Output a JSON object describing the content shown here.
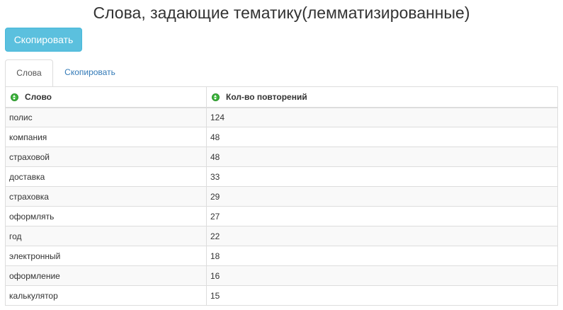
{
  "page": {
    "title": "Слова, задающие тематику(лемматизированные)"
  },
  "toolbar": {
    "copy_label": "Скопировать"
  },
  "tabs": [
    {
      "label": "Слова",
      "active": true
    },
    {
      "label": "Скопировать",
      "active": false
    }
  ],
  "table": {
    "columns": [
      "Слово",
      "Кол-во повторений"
    ],
    "rows": [
      [
        "полис",
        "124"
      ],
      [
        "компания",
        "48"
      ],
      [
        "страховой",
        "48"
      ],
      [
        "доставка",
        "33"
      ],
      [
        "страховка",
        "29"
      ],
      [
        "оформлять",
        "27"
      ],
      [
        "год",
        "22"
      ],
      [
        "электронный",
        "18"
      ],
      [
        "оформление",
        "16"
      ],
      [
        "калькулятор",
        "15"
      ]
    ]
  },
  "colors": {
    "button": "#5bc0de",
    "link": "#337ab7",
    "sort_icon": "#3cb43c",
    "stripe": "#f9f9f9",
    "border": "#dddddd"
  }
}
